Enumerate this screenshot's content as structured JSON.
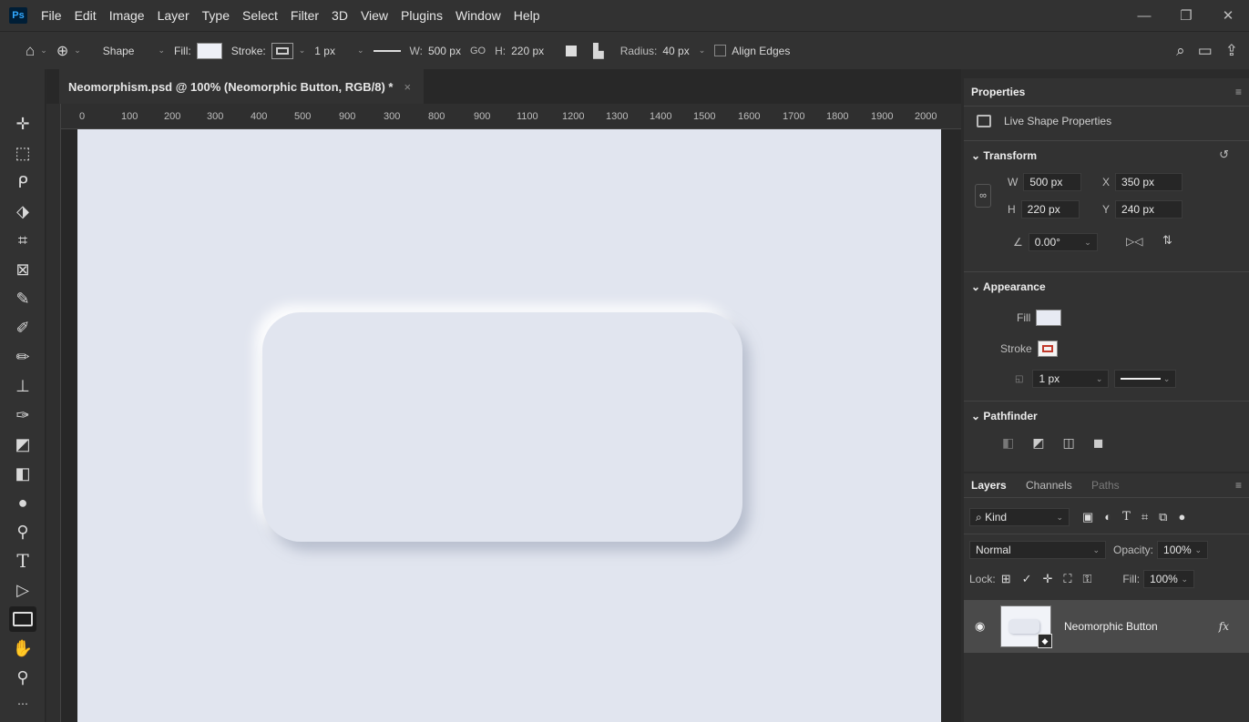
{
  "app": {
    "logo": "Ps",
    "menu": [
      "File",
      "Edit",
      "Image",
      "Layer",
      "Type",
      "Select",
      "Filter",
      "3D",
      "View",
      "Plugins",
      "Window",
      "Help"
    ],
    "window_controls": [
      "—",
      "❐",
      "✕"
    ]
  },
  "options_bar": {
    "tool_mode": "Shape",
    "fill_label": "Fill:",
    "stroke_label": "Stroke:",
    "stroke_width": "1 px",
    "w_label": "W:",
    "w_value": "500 px",
    "link_icon": "GO",
    "h_label": "H:",
    "h_value": "220 px",
    "radius_label": "Radius:",
    "radius_value": "40 px",
    "align_edges": "Align Edges",
    "fill_color": "#eef0f7"
  },
  "document": {
    "tab_title": "Neomorphism.psd @ 100% (Neomorphic Button, RGB/8) *",
    "tab_close": "×",
    "ruler_top": [
      "0",
      "100",
      "200",
      "300",
      "400",
      "500",
      "900",
      "300",
      "800",
      "900",
      "1100",
      "1200",
      "1300",
      "1400",
      "1500",
      "1600",
      "1700",
      "1800",
      "1900",
      "2000"
    ],
    "canvas_color": "#e1e5ef"
  },
  "properties": {
    "tab": "Properties",
    "live_shape": "Live Shape Properties",
    "transform": {
      "header": "Transform",
      "w_label": "W",
      "w_value": "500 px",
      "x_label": "X",
      "x_value": "350 px",
      "h_label": "H",
      "h_value": "220 px",
      "y_label": "Y",
      "y_value": "240 px",
      "angle": "0.00°"
    },
    "appearance": {
      "header": "Appearance",
      "fill_label": "Fill",
      "stroke_label": "Stroke",
      "stroke_width": "1 px"
    },
    "pathfinder": {
      "header": "Pathfinder"
    }
  },
  "layers": {
    "tabs": [
      "Layers",
      "Channels",
      "Paths"
    ],
    "kind": "Kind",
    "blend_mode": "Normal",
    "opacity_label": "Opacity:",
    "opacity_value": "100%",
    "lock_label": "Lock:",
    "fill_label": "Fill:",
    "fill_value": "100%",
    "layer_name": "Neomorphic Button",
    "fx": "fx"
  }
}
